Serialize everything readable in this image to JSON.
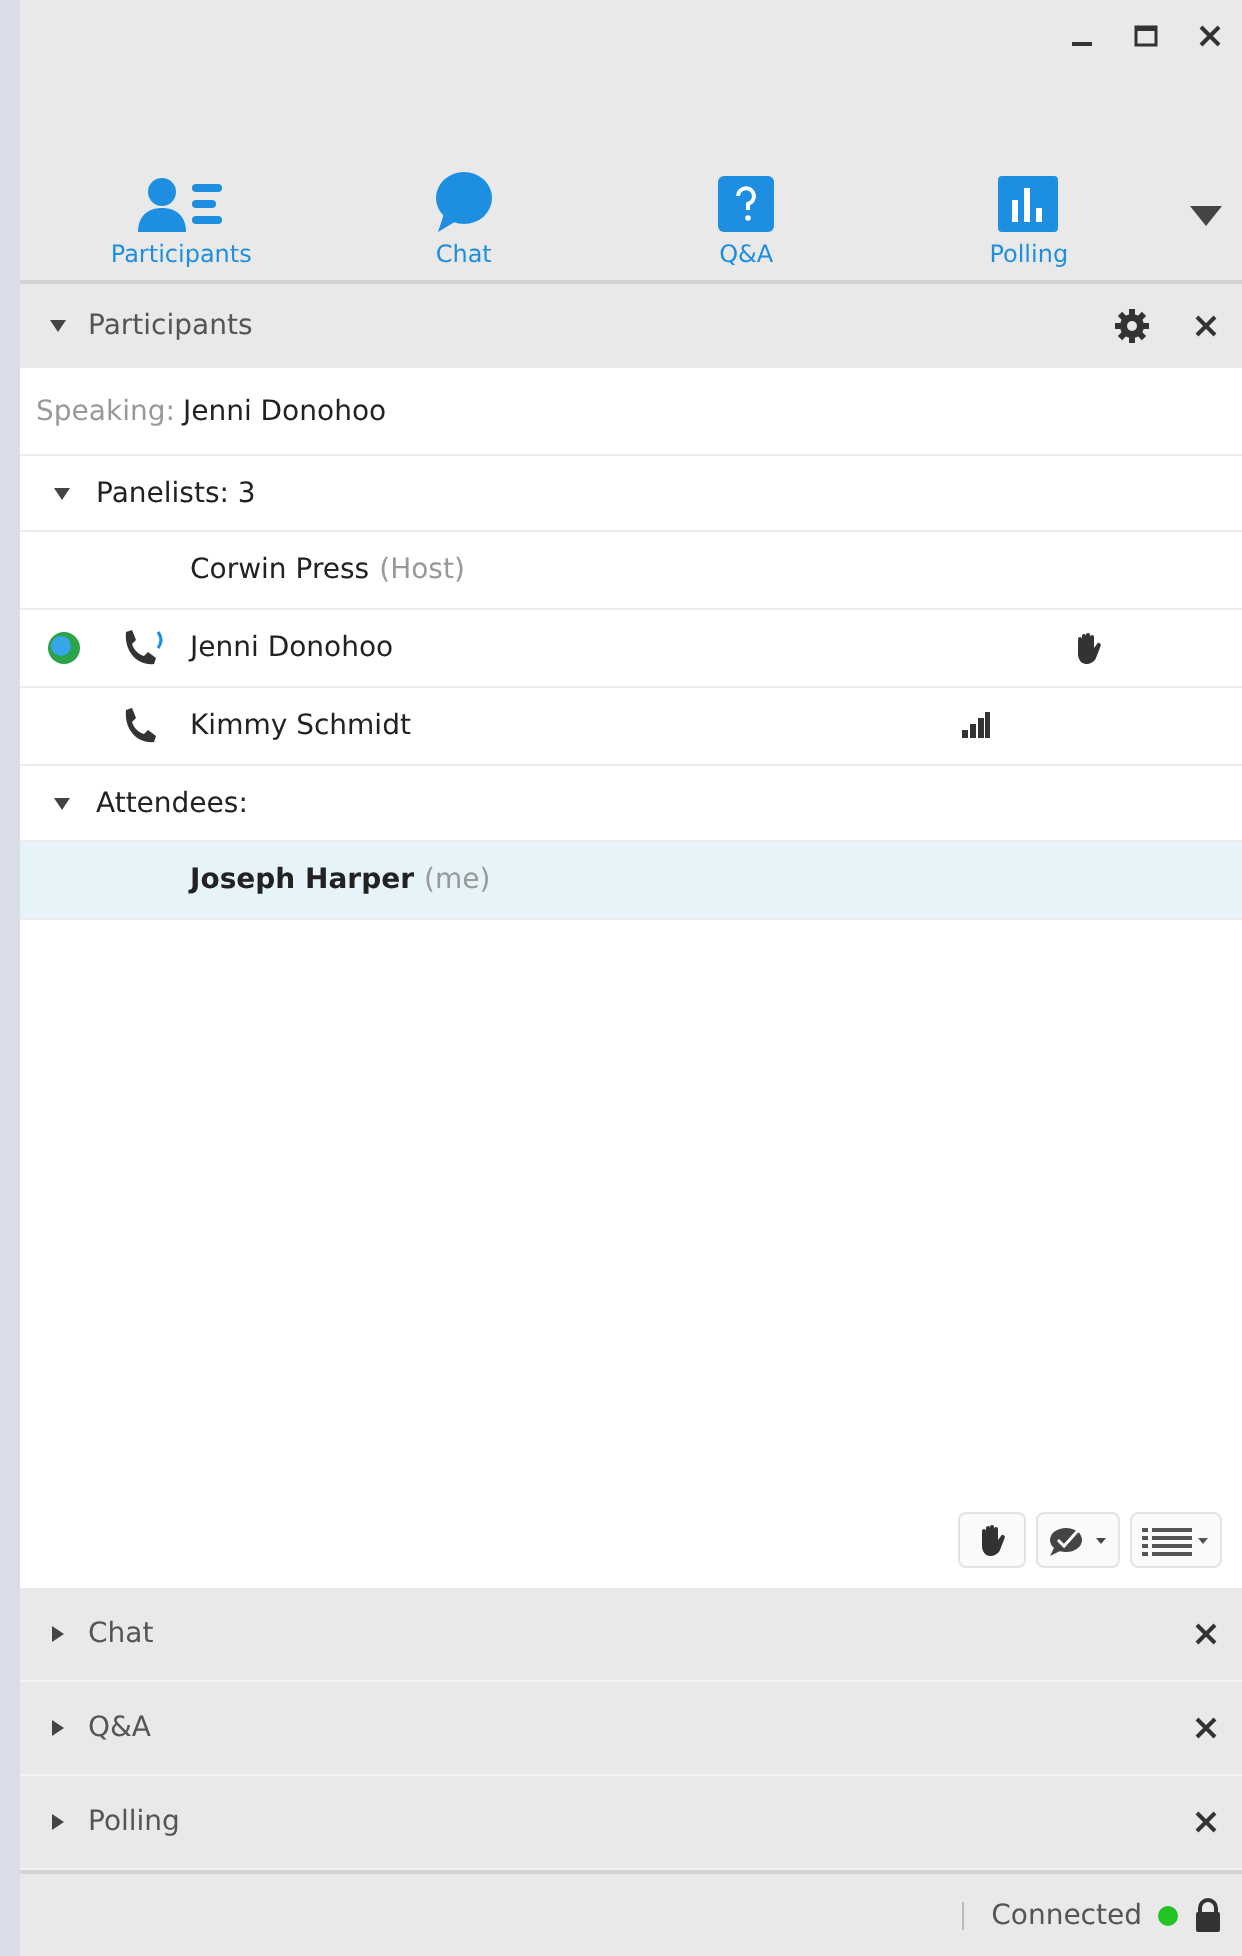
{
  "tabs": [
    {
      "label": "Participants",
      "kind": "participants"
    },
    {
      "label": "Chat",
      "kind": "chat"
    },
    {
      "label": "Q&A",
      "kind": "qa"
    },
    {
      "label": "Polling",
      "kind": "polling"
    }
  ],
  "participants_panel": {
    "title": "Participants",
    "expanded": true,
    "speaking": {
      "label": "Speaking:",
      "name": "Jenni Donohoo"
    },
    "groups": [
      {
        "title": "Panelists: 3",
        "expanded": true,
        "members": [
          {
            "name": "Corwin Press",
            "role": "(Host)",
            "video": false,
            "phone": false,
            "hand_raised": false,
            "audio_meter": false,
            "me": false,
            "selected": false
          },
          {
            "name": "Jenni Donohoo",
            "video": true,
            "phone": true,
            "speaking": true,
            "hand_raised": true,
            "audio_meter": false,
            "me": false,
            "selected": false
          },
          {
            "name": "Kimmy Schmidt",
            "video": false,
            "phone": true,
            "speaking": false,
            "hand_raised": false,
            "audio_meter": true,
            "me": false,
            "selected": false
          }
        ]
      },
      {
        "title": "Attendees:",
        "expanded": true,
        "members": [
          {
            "name": "Joseph Harper",
            "role": "(me)",
            "video": false,
            "phone": false,
            "hand_raised": false,
            "audio_meter": false,
            "me": true,
            "selected": true
          }
        ]
      }
    ]
  },
  "panels": [
    {
      "title": "Chat",
      "expanded": false
    },
    {
      "title": "Q&A",
      "expanded": false
    },
    {
      "title": "Polling",
      "expanded": false
    }
  ],
  "status_bar": {
    "text": "Connected",
    "connected": true
  }
}
